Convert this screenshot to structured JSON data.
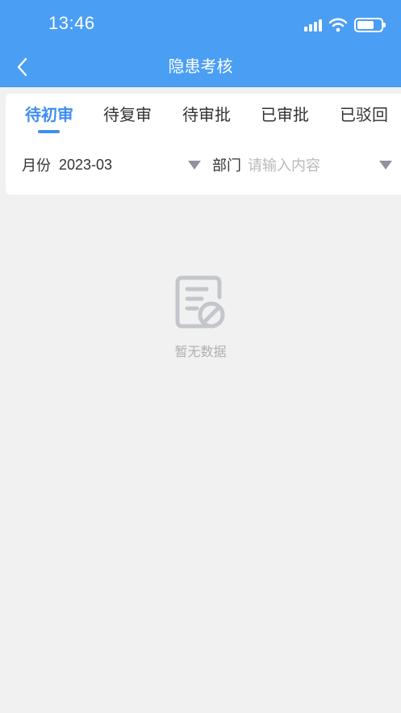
{
  "status_bar": {
    "time": "13:46"
  },
  "nav": {
    "title": "隐患考核"
  },
  "tabs": [
    {
      "label": "待初审",
      "active": true
    },
    {
      "label": "待复审",
      "active": false
    },
    {
      "label": "待审批",
      "active": false
    },
    {
      "label": "已审批",
      "active": false
    },
    {
      "label": "已驳回",
      "active": false
    }
  ],
  "filters": {
    "month": {
      "label": "月份",
      "value": "2023-03"
    },
    "department": {
      "label": "部门",
      "placeholder": "请输入内容"
    }
  },
  "empty_state": {
    "text": "暂无数据",
    "icon": "no-data-document-icon"
  },
  "colors": {
    "header": "#4a9ef4",
    "accent": "#3f8ef0",
    "background": "#f1f1f1"
  }
}
